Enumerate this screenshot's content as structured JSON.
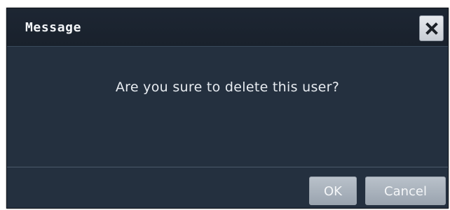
{
  "dialog": {
    "title": "Message",
    "close_icon": "close-icon",
    "message": "Are you sure to delete this user?",
    "buttons": {
      "ok_label": "OK",
      "cancel_label": "Cancel"
    }
  },
  "colors": {
    "dialog_background": "#24303f",
    "titlebar_background": "#1d2633",
    "button_background": "#b9c1ca",
    "text": "#e8ecf1"
  }
}
